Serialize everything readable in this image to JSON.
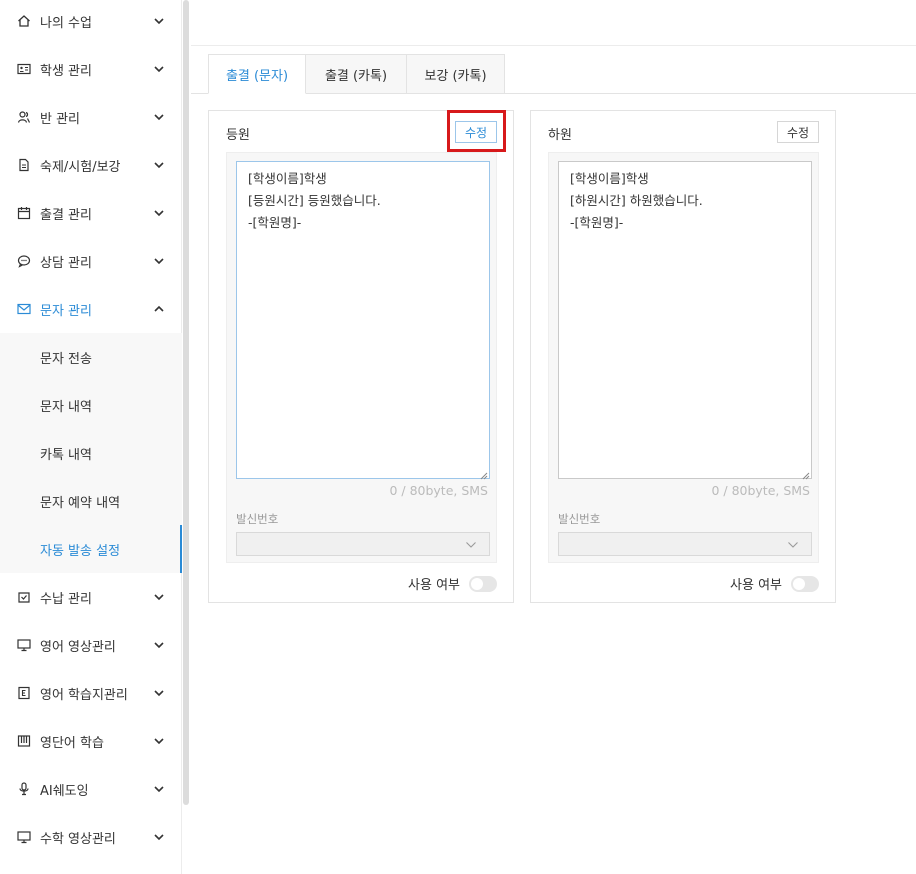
{
  "sidebar": {
    "items": [
      {
        "label": "나의 수업",
        "icon": "home-icon"
      },
      {
        "label": "학생 관리",
        "icon": "id-card-icon"
      },
      {
        "label": "반 관리",
        "icon": "users-icon"
      },
      {
        "label": "숙제/시험/보강",
        "icon": "document-icon"
      },
      {
        "label": "출결 관리",
        "icon": "calendar-icon"
      },
      {
        "label": "상담 관리",
        "icon": "chat-icon"
      },
      {
        "label": "문자 관리",
        "icon": "mail-icon",
        "expanded": true
      },
      {
        "label": "수납 관리",
        "icon": "receipt-icon"
      },
      {
        "label": "영어 영상관리",
        "icon": "monitor-icon"
      },
      {
        "label": "영어 학습지관리",
        "icon": "e-book-icon"
      },
      {
        "label": "영단어 학습",
        "icon": "piano-icon"
      },
      {
        "label": "AI쉐도잉",
        "icon": "microphone-icon"
      },
      {
        "label": "수학 영상관리",
        "icon": "monitor-icon"
      }
    ],
    "sub_items": [
      {
        "label": "문자 전송"
      },
      {
        "label": "문자 내역"
      },
      {
        "label": "카톡 내역"
      },
      {
        "label": "문자 예약 내역"
      },
      {
        "label": "자동 발송 설정",
        "active": true
      }
    ]
  },
  "tabs": [
    {
      "label": "출결 (문자)",
      "active": true
    },
    {
      "label": "출결 (카톡)"
    },
    {
      "label": "보강 (카톡)"
    }
  ],
  "cards": [
    {
      "title": "등원",
      "edit_label": "수정",
      "message": "[학생이름]학생\n[등원시간] 등원했습니다.\n-[학원명]-",
      "counter": "0 / 80byte, SMS",
      "sender_label": "발신번호",
      "sender_value": "",
      "use_label": "사용 여부",
      "enabled": false
    },
    {
      "title": "하원",
      "edit_label": "수정",
      "message": "[학생이름]학생\n[하원시간] 하원했습니다.\n-[학원명]-",
      "counter": "0 / 80byte, SMS",
      "sender_label": "발신번호",
      "sender_value": "",
      "use_label": "사용 여부",
      "enabled": false
    }
  ],
  "colors": {
    "accent": "#2b8bd6",
    "highlight": "#d7191b"
  }
}
